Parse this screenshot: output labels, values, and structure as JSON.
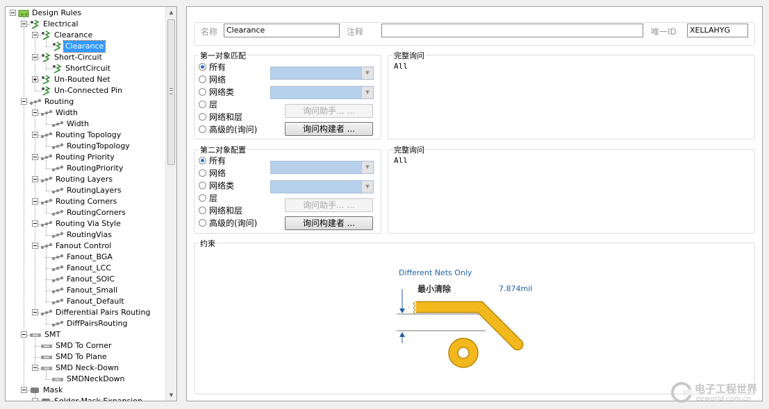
{
  "tree": [
    {
      "label": "Design Rules",
      "level": 0,
      "toggle": "minus",
      "icon": "design-rules-icon"
    },
    {
      "label": "Electrical",
      "level": 1,
      "toggle": "minus",
      "icon": "electrical-rule-icon"
    },
    {
      "label": "Clearance",
      "level": 2,
      "toggle": "minus",
      "icon": "electrical-rule-icon"
    },
    {
      "label": "Clearance",
      "level": 3,
      "toggle": "",
      "icon": "electrical-rule-icon",
      "selected": true
    },
    {
      "label": "Short-Circuit",
      "level": 2,
      "toggle": "minus",
      "icon": "electrical-rule-icon"
    },
    {
      "label": "ShortCircuit",
      "level": 3,
      "toggle": "",
      "icon": "electrical-rule-icon"
    },
    {
      "label": "Un-Routed Net",
      "level": 2,
      "toggle": "plus",
      "icon": "electrical-rule-icon"
    },
    {
      "label": "Un-Connected Pin",
      "level": 2,
      "toggle": "",
      "icon": "electrical-rule-icon"
    },
    {
      "label": "Routing",
      "level": 1,
      "toggle": "minus",
      "icon": "routing-rule-icon"
    },
    {
      "label": "Width",
      "level": 2,
      "toggle": "minus",
      "icon": "routing-rule-icon"
    },
    {
      "label": "Width",
      "level": 3,
      "toggle": "",
      "icon": "routing-rule-icon"
    },
    {
      "label": "Routing Topology",
      "level": 2,
      "toggle": "minus",
      "icon": "routing-rule-icon"
    },
    {
      "label": "RoutingTopology",
      "level": 3,
      "toggle": "",
      "icon": "routing-rule-icon"
    },
    {
      "label": "Routing Priority",
      "level": 2,
      "toggle": "minus",
      "icon": "routing-rule-icon"
    },
    {
      "label": "RoutingPriority",
      "level": 3,
      "toggle": "",
      "icon": "routing-rule-icon"
    },
    {
      "label": "Routing Layers",
      "level": 2,
      "toggle": "minus",
      "icon": "routing-rule-icon"
    },
    {
      "label": "RoutingLayers",
      "level": 3,
      "toggle": "",
      "icon": "routing-rule-icon"
    },
    {
      "label": "Routing Corners",
      "level": 2,
      "toggle": "minus",
      "icon": "routing-rule-icon"
    },
    {
      "label": "RoutingCorners",
      "level": 3,
      "toggle": "",
      "icon": "routing-rule-icon"
    },
    {
      "label": "Routing Via Style",
      "level": 2,
      "toggle": "minus",
      "icon": "routing-rule-icon"
    },
    {
      "label": "RoutingVias",
      "level": 3,
      "toggle": "",
      "icon": "routing-rule-icon"
    },
    {
      "label": "Fanout Control",
      "level": 2,
      "toggle": "minus",
      "icon": "routing-rule-icon"
    },
    {
      "label": "Fanout_BGA",
      "level": 3,
      "toggle": "",
      "icon": "routing-rule-icon"
    },
    {
      "label": "Fanout_LCC",
      "level": 3,
      "toggle": "",
      "icon": "routing-rule-icon"
    },
    {
      "label": "Fanout_SOIC",
      "level": 3,
      "toggle": "",
      "icon": "routing-rule-icon"
    },
    {
      "label": "Fanout_Small",
      "level": 3,
      "toggle": "",
      "icon": "routing-rule-icon"
    },
    {
      "label": "Fanout_Default",
      "level": 3,
      "toggle": "",
      "icon": "routing-rule-icon"
    },
    {
      "label": "Differential Pairs Routing",
      "level": 2,
      "toggle": "minus",
      "icon": "routing-rule-icon"
    },
    {
      "label": "DiffPairsRouting",
      "level": 3,
      "toggle": "",
      "icon": "routing-rule-icon"
    },
    {
      "label": "SMT",
      "level": 1,
      "toggle": "minus",
      "icon": "smt-rule-icon"
    },
    {
      "label": "SMD To Corner",
      "level": 2,
      "toggle": "",
      "icon": "smt-rule-icon"
    },
    {
      "label": "SMD To Plane",
      "level": 2,
      "toggle": "",
      "icon": "smt-rule-icon"
    },
    {
      "label": "SMD Neck-Down",
      "level": 2,
      "toggle": "minus",
      "icon": "smt-rule-icon"
    },
    {
      "label": "SMDNeckDown",
      "level": 3,
      "toggle": "",
      "icon": "smt-rule-icon"
    },
    {
      "label": "Mask",
      "level": 1,
      "toggle": "minus",
      "icon": "mask-rule-icon"
    },
    {
      "label": "Solder Mask Expansion",
      "level": 2,
      "toggle": "minus",
      "icon": "mask-rule-icon"
    }
  ],
  "header": {
    "name_label": "名称",
    "name_value": "Clearance",
    "comment_label": "注释",
    "comment_value": "",
    "id_label": "唯一ID",
    "id_value": "XELLAHYG"
  },
  "first": {
    "title": "第一对象匹配",
    "options": [
      "所有",
      "网络",
      "网络类",
      "层",
      "网络和层",
      "高级的(询问)"
    ],
    "selected": 0,
    "helper_btn": "询问助手... ...",
    "builder_btn": "询问构建者 ...",
    "query_title": "完整询问",
    "query_text": "All"
  },
  "second": {
    "title": "第二对象配置",
    "options": [
      "所有",
      "网络",
      "网络类",
      "层",
      "网络和层",
      "高级的(询问)"
    ],
    "selected": 0,
    "helper_btn": "询问助手... ...",
    "builder_btn": "询问构建者 ...",
    "query_title": "完整询问",
    "query_text": "All"
  },
  "constraints": {
    "title": "约束",
    "mode_label": "Different Nets Only",
    "min_clearance_label": "最小清除",
    "min_clearance_value": "7.874mil"
  },
  "watermark": {
    "text": "电子工程世界",
    "sub": "eeworld.com.cn"
  },
  "colors": {
    "selection": "#3399ff",
    "trace": "#f2b81c",
    "trace_outline": "#b8860b",
    "link_blue": "#1f5fa8",
    "combo_fill": "#b7d0ec"
  }
}
